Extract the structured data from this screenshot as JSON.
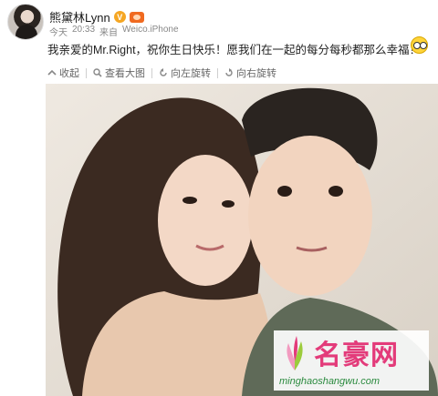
{
  "user": {
    "name": "熊黛林Lynn",
    "verified_badge": "V"
  },
  "meta": {
    "date": "今天",
    "time": "20:33",
    "source_prefix": "来自",
    "source": "Weico.iPhone"
  },
  "post": {
    "text": "我亲爱的Mr.Right，祝你生日快乐！愿我们在一起的每分每秒都那么幸福！"
  },
  "toolbar": {
    "collapse_label": "收起",
    "view_large_label": "查看大图",
    "rotate_left_label": "向左旋转",
    "rotate_right_label": "向右旋转"
  },
  "watermark": {
    "name": "名豪网",
    "url": "minghaoshangwu.com"
  },
  "colors": {
    "badge": "#f5a623",
    "watermark_pink": "#e33b7a",
    "watermark_green": "#2a8a3e"
  }
}
